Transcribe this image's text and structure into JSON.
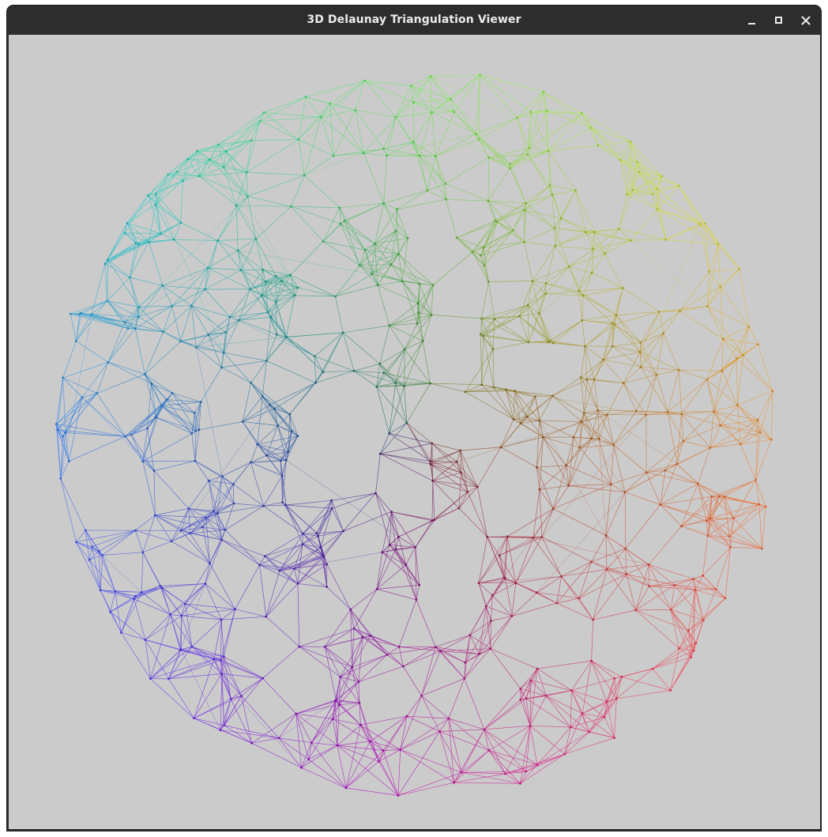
{
  "window": {
    "title": "3D Delaunay Triangulation Viewer",
    "controls": {
      "minimize_icon": "minimize-icon",
      "maximize_icon": "maximize-icon",
      "close_icon": "close-icon"
    }
  },
  "viewport": {
    "background": "#cbcbcb",
    "mesh_colors": {
      "top": "#7cf06a",
      "right": "#f0844a",
      "bottom": "#c025c0",
      "left": "#4a7ef0",
      "upper_left": "#3ad0c8",
      "upper_right": "#d8e048",
      "lower_right": "#f04a70",
      "lower_left": "#7048f0",
      "center": "#3a3a3a"
    }
  }
}
